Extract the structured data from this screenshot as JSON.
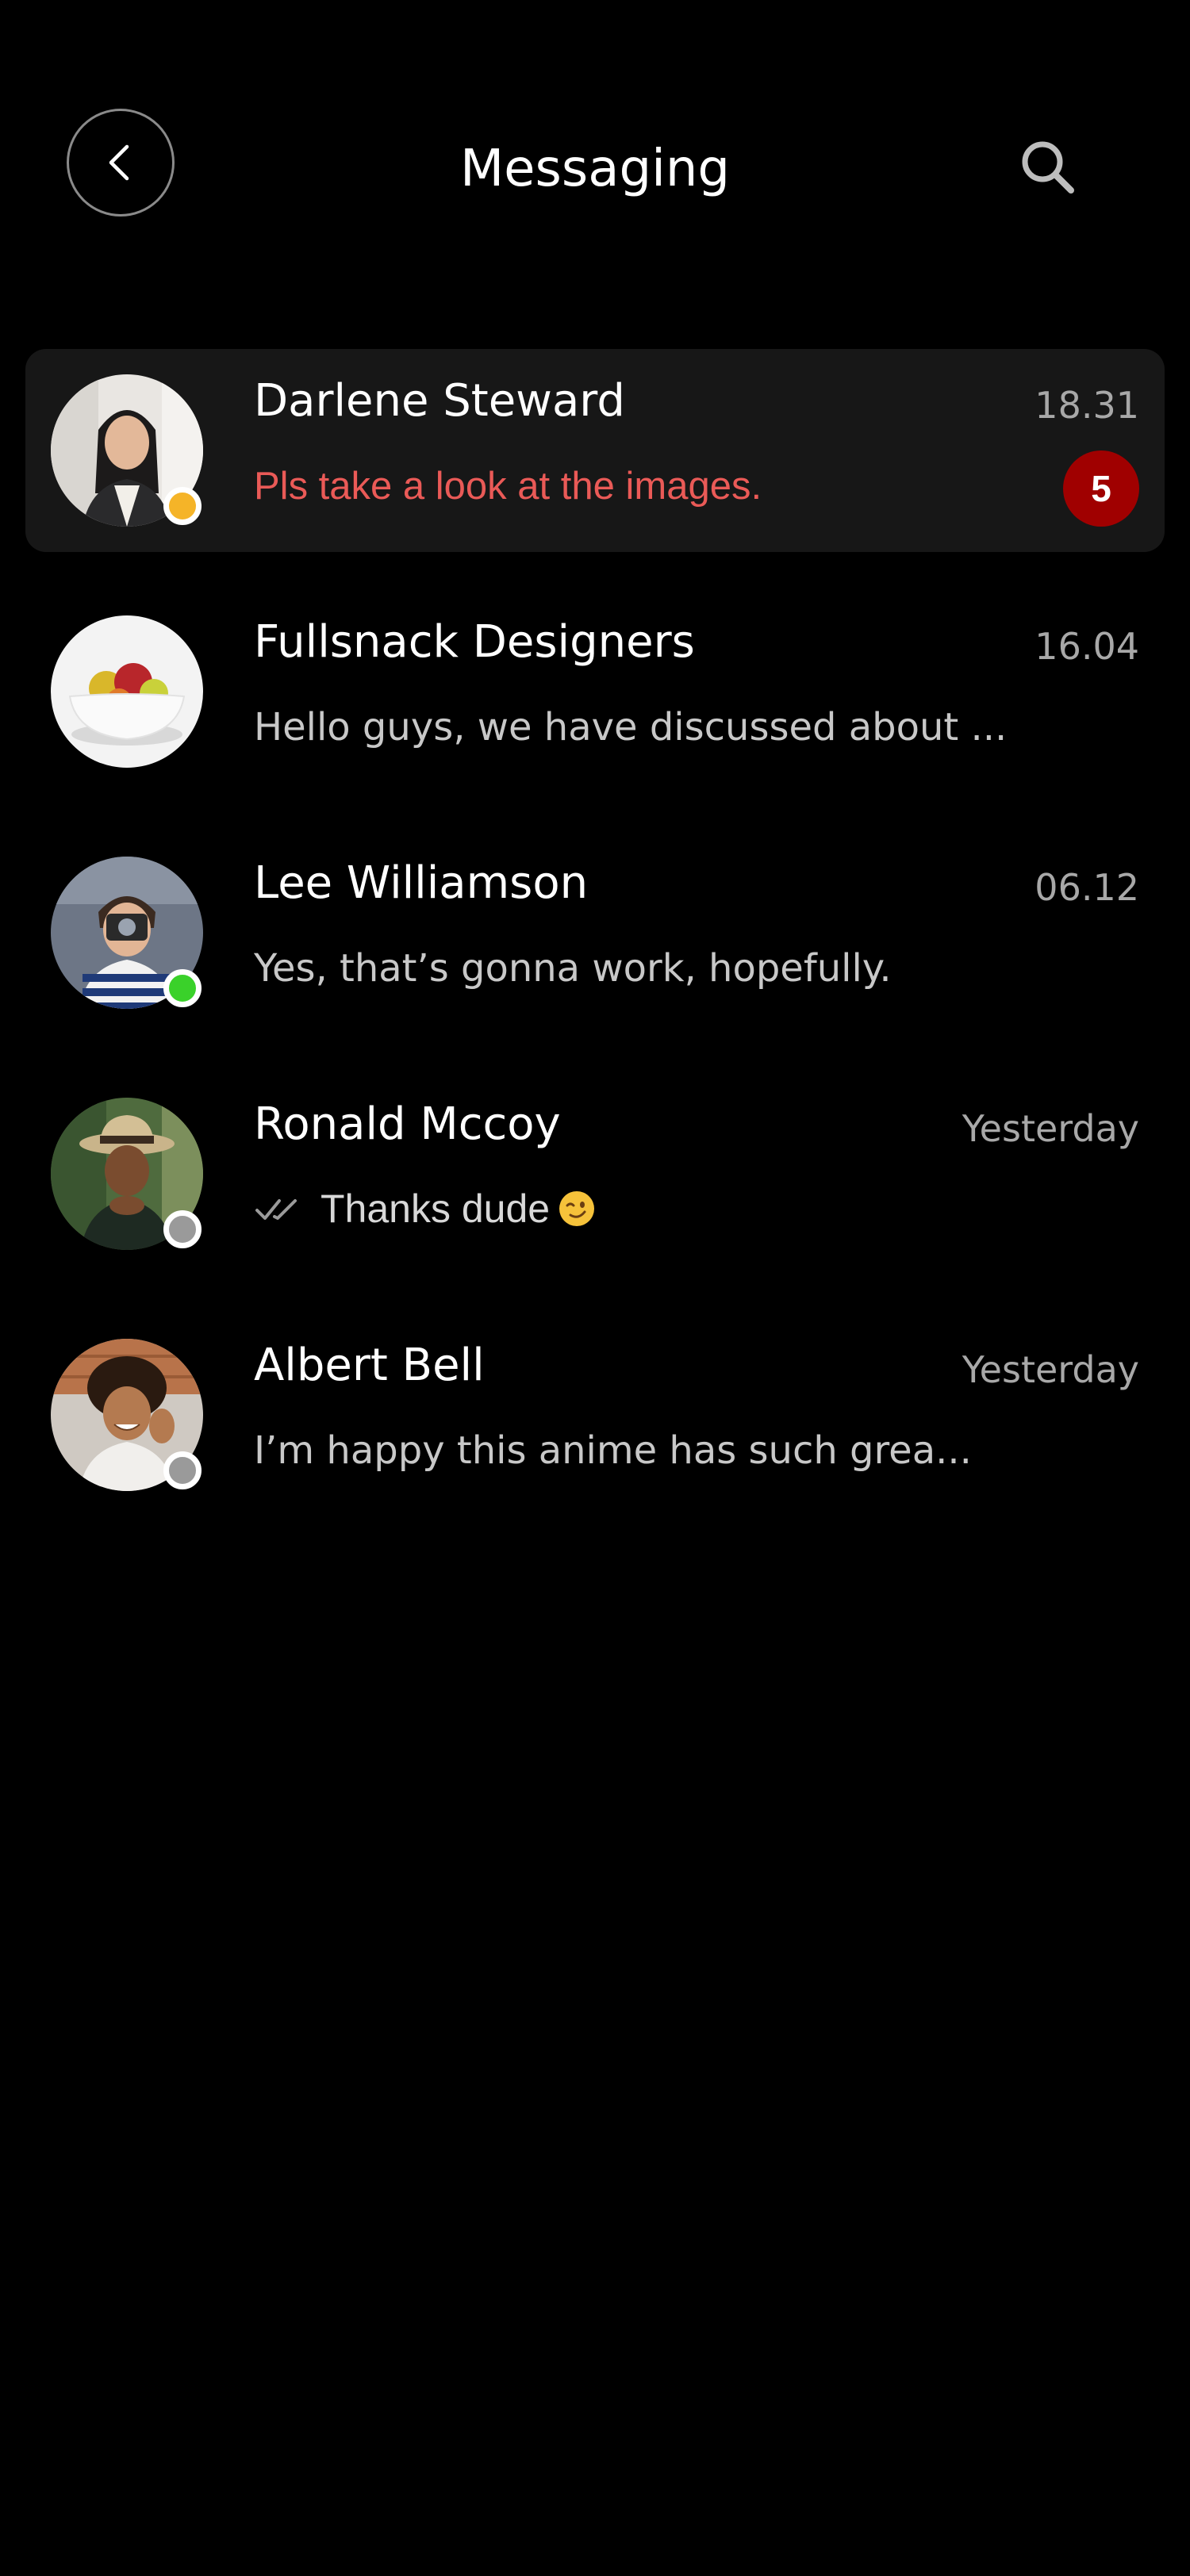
{
  "header": {
    "title": "Messaging",
    "back_icon": "chevron-left-icon",
    "search_icon": "search-icon"
  },
  "colors": {
    "background": "#000000",
    "active_row": "#171717",
    "unread_text": "#ea5a57",
    "badge": "#a00000",
    "status_away": "#f5b428",
    "status_online": "#3ad12a",
    "status_offline": "#9a9a9a"
  },
  "conversations": [
    {
      "name": "Darlene Steward",
      "time": "18.31",
      "preview": "Pls take a look at the images.",
      "unread_count": "5",
      "status": "away",
      "avatar": "woman-portrait-avatar"
    },
    {
      "name": "Fullsnack Designers",
      "time": "16.04",
      "preview": "Hello guys, we have discussed about ...",
      "status": "none",
      "avatar": "fruit-bowl-avatar"
    },
    {
      "name": "Lee Williamson",
      "time": "06.12",
      "preview": "Yes, that’s gonna work, hopefully.",
      "status": "online",
      "avatar": "man-with-camera-avatar"
    },
    {
      "name": "Ronald Mccoy",
      "time": "Yesterday",
      "preview": "Thanks dude",
      "preview_icon": "double-check-icon",
      "preview_emoji": "winking-face-emoji",
      "status": "offline",
      "avatar": "man-with-hat-avatar"
    },
    {
      "name": "Albert Bell",
      "time": "Yesterday",
      "preview": "I’m happy this anime has such grea...",
      "status": "offline",
      "avatar": "curly-hair-man-avatar"
    }
  ]
}
